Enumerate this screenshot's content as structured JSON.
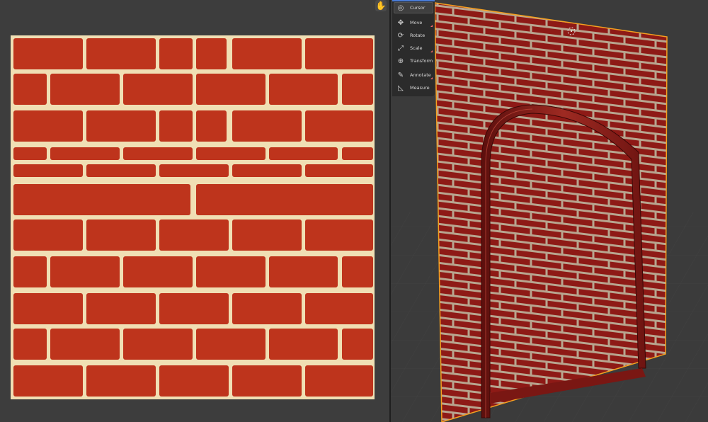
{
  "image_editor": {
    "hand_icon": "hand-icon"
  },
  "toolbar": {
    "items": [
      {
        "label": "Cursor",
        "icon": "cursor-icon",
        "active": true
      },
      {
        "label": "Move",
        "icon": "move-icon"
      },
      {
        "label": "Rotate",
        "icon": "rotate-icon"
      },
      {
        "label": "Scale",
        "icon": "scale-icon"
      },
      {
        "label": "Transform",
        "icon": "transform-icon"
      },
      {
        "label": "Annotate",
        "icon": "annotate-icon"
      },
      {
        "label": "Measure",
        "icon": "measure-icon"
      }
    ]
  },
  "viewport": {
    "header_text": ""
  },
  "colors": {
    "brick": "#be341c",
    "mortar": "#f0dfb4",
    "wall_brick": "#8e1a16",
    "wall_mortar": "#b8a58f",
    "selection": "#f5a020"
  }
}
